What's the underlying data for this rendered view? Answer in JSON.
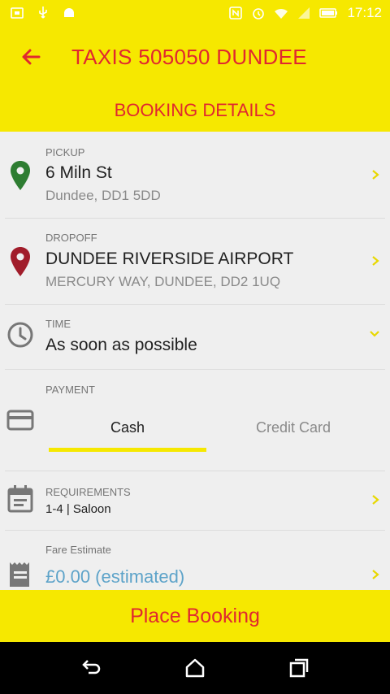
{
  "status_bar": {
    "time": "17:12",
    "icons": [
      "screenshot-icon",
      "usb-icon",
      "android-icon",
      "nfc-icon",
      "alarm-icon",
      "wifi-icon",
      "signal-icon",
      "battery-icon"
    ]
  },
  "header": {
    "title": "TAXIS 505050 DUNDEE",
    "subtitle": "BOOKING DETAILS"
  },
  "pickup": {
    "label": "PICKUP",
    "address": "6 Miln St",
    "detail": "Dundee, DD1 5DD",
    "icon_color": "#2e7d32"
  },
  "dropoff": {
    "label": "DROPOFF",
    "address": "DUNDEE RIVERSIDE AIRPORT",
    "detail": "MERCURY WAY, DUNDEE, DD2 1UQ",
    "icon_color": "#a11d2b"
  },
  "time": {
    "label": "TIME",
    "value": "As soon as possible"
  },
  "payment": {
    "label": "PAYMENT",
    "options": [
      "Cash",
      "Credit Card"
    ],
    "selected": "Cash"
  },
  "requirements": {
    "label": "REQUIREMENTS",
    "value": "1-4 | Saloon"
  },
  "fare": {
    "label": "Fare Estimate",
    "value": "£0.00 (estimated)"
  },
  "action": {
    "place_booking": "Place Booking"
  },
  "colors": {
    "accent": "#f6e800",
    "brand_text": "#e0282f",
    "chevron": "#e8d800"
  }
}
